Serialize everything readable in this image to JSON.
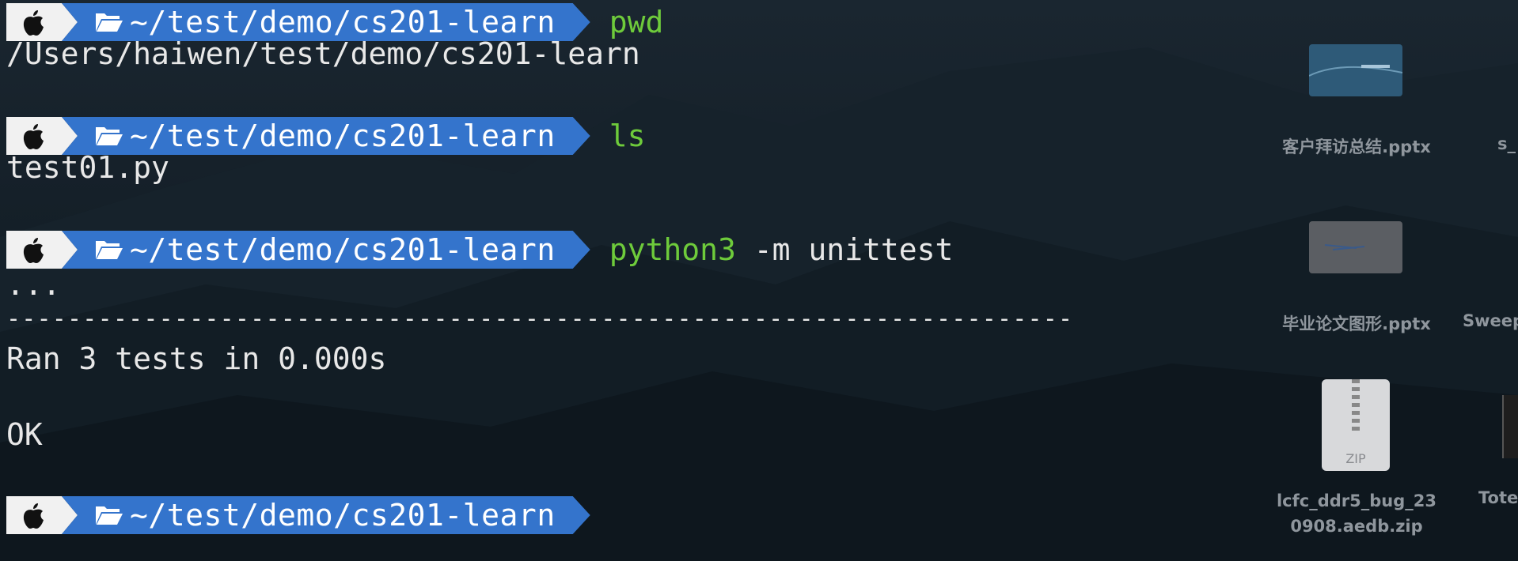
{
  "terminal": {
    "path_label": "~/test/demo/cs201-learn",
    "prompts": [
      {
        "command": "pwd",
        "args": ""
      },
      {
        "command": "ls",
        "args": ""
      },
      {
        "command": "python3",
        "args": "-m unittest"
      },
      {
        "command": "",
        "args": ""
      }
    ],
    "outputs": {
      "pwd": "/Users/haiwen/test/demo/cs201-learn",
      "ls": "test01.py",
      "dots": "...",
      "separator": "----------------------------------------------------------------------",
      "ran": "Ran 3 tests in 0.000s",
      "ok": "OK"
    }
  },
  "desktop": {
    "items": [
      {
        "name": "客户拜访总结.pptx",
        "kind": "pptx-thumbnail"
      },
      {
        "name": "s_",
        "kind": "partial"
      },
      {
        "name": "毕业论文图形.pptx",
        "kind": "pptx-thumbnail"
      },
      {
        "name": "Sweep",
        "kind": "partial"
      },
      {
        "name": "lcfc_ddr5_bug_23",
        "name_line2": "0908.aedb.zip",
        "kind": "zip"
      },
      {
        "name": "Tote",
        "kind": "partial"
      }
    ],
    "zip_badge": "ZIP"
  },
  "colors": {
    "path_bg": "#3474cc",
    "apple_bg": "#f1f1f1",
    "command": "#6ecb3b",
    "text": "#e8e8e8"
  },
  "icons": [
    "apple-icon",
    "folder-open-icon",
    "zip-file-icon"
  ]
}
